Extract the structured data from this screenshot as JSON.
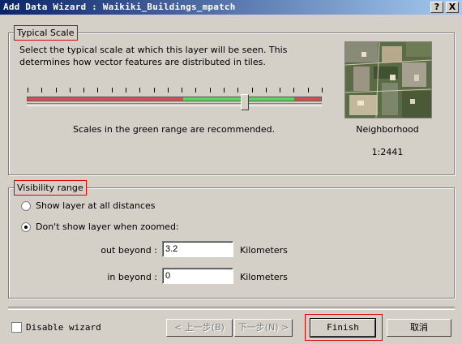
{
  "window": {
    "title": "Add Data Wizard : Waikiki_Buildings_mpatch",
    "help_button": "?",
    "close_button": "X"
  },
  "typical_scale": {
    "label": "Typical Scale",
    "description": "Select the typical scale at which this layer will be seen. This determines how vector features are distributed in tiles.",
    "slider_value": 0.74,
    "slider_segments": [
      {
        "color": "#d45050",
        "fraction": 0.53
      },
      {
        "color": "#5bd65b",
        "fraction": 0.38
      },
      {
        "color": "#d45050",
        "fraction": 0.09
      }
    ],
    "tick_count": 22,
    "recommendation": "Scales in the green range are recommended.",
    "preview_name": "Neighborhood",
    "preview_scale": "1:2441"
  },
  "visibility": {
    "label": "Visibility range",
    "option_all": "Show layer at all distances",
    "option_zoomed": "Don't show layer when zoomed:",
    "selected": "zoomed",
    "out_beyond_label": "out beyond :",
    "out_beyond_value": "3.2",
    "in_beyond_label": "in beyond :",
    "in_beyond_value": "0",
    "unit": "Kilometers"
  },
  "footer": {
    "disable_wizard_label": "Disable wizard",
    "disable_wizard_checked": false,
    "back_label": "< 上一步(B)",
    "next_label": "下一步(N) >",
    "finish_label": "Finish",
    "cancel_label": "取消"
  }
}
